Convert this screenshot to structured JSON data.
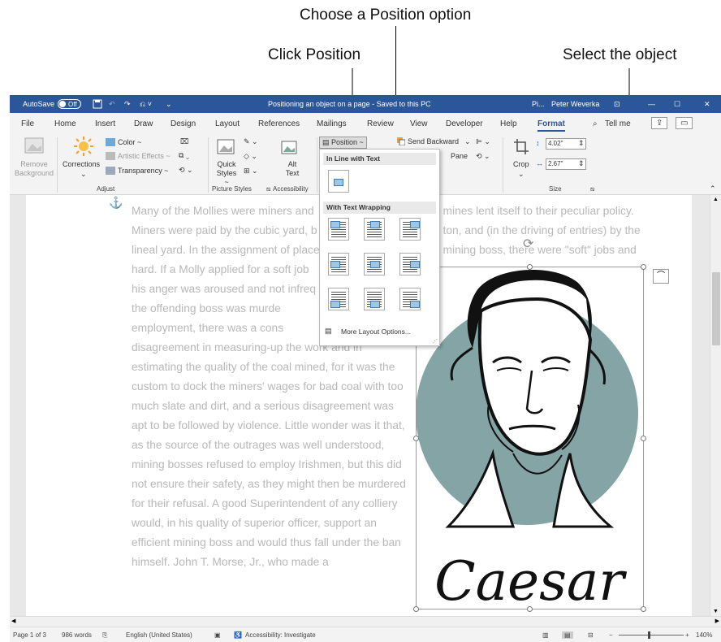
{
  "callouts": {
    "position_option": "Choose a Position option",
    "click_position": "Click Position",
    "select_object": "Select the object"
  },
  "titlebar": {
    "autosave": "AutoSave",
    "autosave_state": "Off",
    "doc_title": "Positioning an object on a page - Saved to this PC",
    "pi": "Pi...",
    "user": "Peter Weverka"
  },
  "tabs": [
    "File",
    "Home",
    "Insert",
    "Draw",
    "Design",
    "Layout",
    "References",
    "Mailings",
    "Review",
    "View",
    "Developer",
    "Help",
    "Format",
    "Tell me"
  ],
  "ribbon": {
    "remove_background": "Remove Background",
    "corrections": "Corrections",
    "color": "Color ~",
    "artistic_effects": "Artistic Effects ~",
    "transparency": "Transparency ~",
    "adjust": "Adjust",
    "quick_styles": "Quick Styles ~",
    "picture_styles": "Picture Styles",
    "alt_text": "Alt Text",
    "accessibility": "Accessibility",
    "position": "Position ~",
    "send_backward": "Send Backward",
    "pane": "Pane",
    "crop": "Crop",
    "height": "4.02\"",
    "width": "2.67\"",
    "size": "Size"
  },
  "dropdown": {
    "inline_header": "In Line with Text",
    "wrap_header": "With Text Wrapping",
    "more_options": "More Layout Options..."
  },
  "document": {
    "lines": [
      "Many of the Mollies were miners and",
      "Miners were paid by the cubic yard, b",
      "lineal yard. In the assignment of place",
      "hard. If a Molly applied for a soft job",
      "his anger was aroused and not infreq",
      "the    offending    boss    was    murde",
      "employment,    there    was    a    cons",
      "disagreement   in   measuring-up   the   work   and   in",
      "estimating the quality of the coal mined, for it was the",
      "custom to dock the miners' wages for bad coal with too",
      "much slate and dirt, and a serious disagreement was",
      "apt to be followed by violence. Little wonder was it that,",
      "as the source of the outrages was well understood,",
      "mining bosses refused to employ Irishmen, but this did",
      "not ensure their safety, as they might then be murdered",
      "for their refusal. A good Superintendent of any colliery",
      "would, in his quality of superior officer, support an",
      "efficient mining boss and would thus fall under the ban",
      "himself.    John    T.    Morse,    Jr.,    who    made    a"
    ],
    "right_lines": [
      "e mines lent itself to their peculiar policy.",
      "e ton, and (in the driving of entries) by the",
      "e mining boss, there were \"soft\" jobs and"
    ],
    "image_caption": "Caesar"
  },
  "status": {
    "page": "Page 1 of 3",
    "words": "986 words",
    "language": "English (United States)",
    "accessibility": "Accessibility: Investigate",
    "zoom": "140%"
  },
  "colors": {
    "word_blue": "#2b579a",
    "circle": "#84a4a6"
  }
}
